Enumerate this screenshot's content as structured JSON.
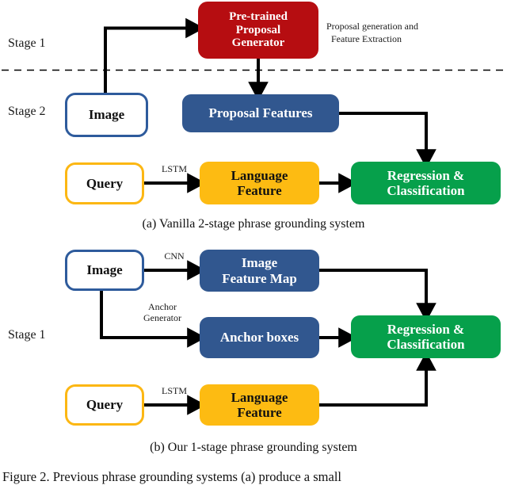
{
  "figure": {
    "caption_a": "(a) Vanilla 2-stage phrase grounding system",
    "caption_b": "(b) Our 1-stage phrase grounding system",
    "figure_caption": "Figure 2. Previous phrase grounding systems (a) produce a small"
  },
  "colors": {
    "red": "#b60d11",
    "blue": "#31578f",
    "blue_border": "#2e5b9c",
    "yellow": "#fdbb12",
    "yellow_border": "#fcb713",
    "green": "#06a04b",
    "black": "#000000",
    "white": "#ffffff"
  },
  "diagram_a": {
    "stage_labels": [
      {
        "text": "Stage 1"
      },
      {
        "text": "Stage 2"
      }
    ],
    "annotation": "Proposal generation and\nFeature Extraction",
    "annotation_line1": "Proposal generation and",
    "annotation_line2": "Feature Extraction",
    "nodes": [
      {
        "id": "pretrained-proposal-generator",
        "label": "Pre-trained\nProposal\nGenerator",
        "line1": "Pre-trained",
        "line2": "Proposal",
        "line3": "Generator",
        "style": "red"
      },
      {
        "id": "image",
        "label": "Image",
        "style": "blue-outline"
      },
      {
        "id": "proposal-features",
        "label": "Proposal Features",
        "style": "blue"
      },
      {
        "id": "query",
        "label": "Query",
        "style": "yellow-outline"
      },
      {
        "id": "language-feature",
        "label": "Language\nFeature",
        "line1": "Language",
        "line2": "Feature",
        "style": "yellow"
      },
      {
        "id": "regression-classification",
        "label": "Regression &\nClassification",
        "line1": "Regression &",
        "line2": "Classification",
        "style": "green"
      }
    ],
    "edge_labels": [
      {
        "id": "lstm",
        "text": "LSTM"
      }
    ]
  },
  "diagram_b": {
    "stage_labels": [
      {
        "text": "Stage 1"
      }
    ],
    "nodes": [
      {
        "id": "image",
        "label": "Image",
        "style": "blue-outline"
      },
      {
        "id": "image-feature-map",
        "label": "Image\nFeature Map",
        "line1": "Image",
        "line2": "Feature Map",
        "style": "blue"
      },
      {
        "id": "anchor-boxes",
        "label": "Anchor boxes",
        "style": "blue"
      },
      {
        "id": "query",
        "label": "Query",
        "style": "yellow-outline"
      },
      {
        "id": "language-feature",
        "label": "Language\nFeature",
        "line1": "Language",
        "line2": "Feature",
        "style": "yellow"
      },
      {
        "id": "regression-classification",
        "label": "Regression &\nClassification",
        "line1": "Regression &",
        "line2": "Classification",
        "style": "green"
      }
    ],
    "edge_labels": [
      {
        "id": "cnn",
        "text": "CNN"
      },
      {
        "id": "anchor-generator-line1",
        "text": "Anchor"
      },
      {
        "id": "anchor-generator-line2",
        "text": "Generator"
      },
      {
        "id": "lstm",
        "text": "LSTM"
      }
    ]
  }
}
